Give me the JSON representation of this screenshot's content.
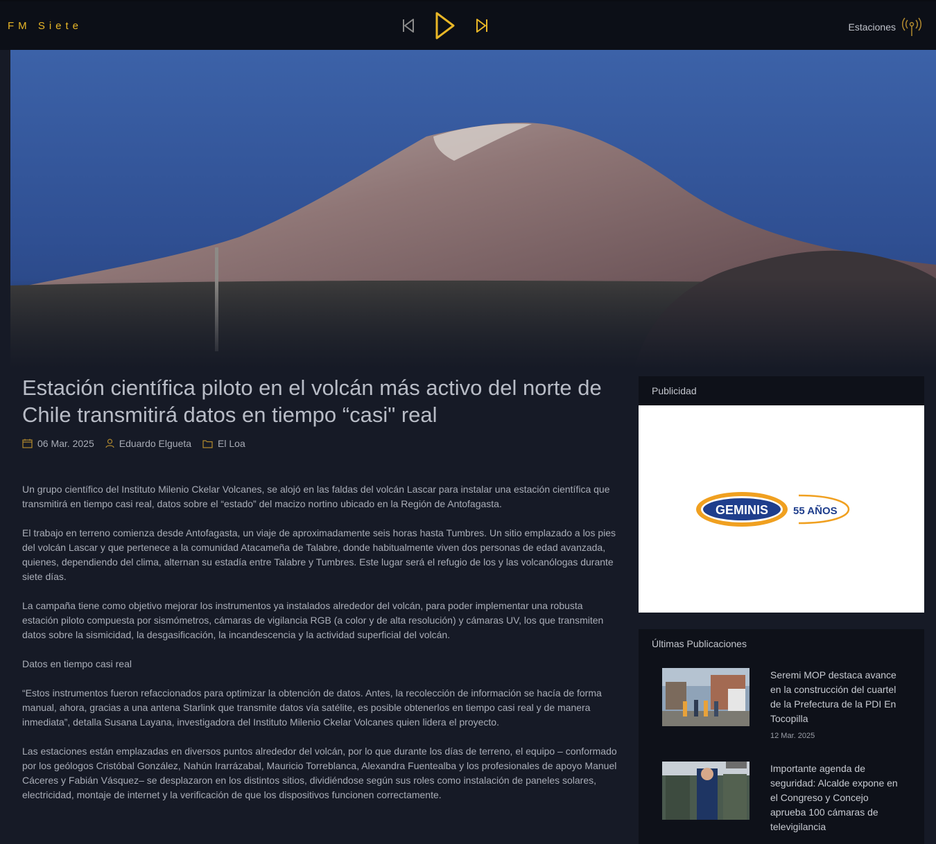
{
  "header": {
    "brand": "FM Siete",
    "stations_label": "Estaciones"
  },
  "article": {
    "title": "Estación científica piloto en el volcán más activo del norte de Chile transmitirá datos en tiempo “casi\" real",
    "date": "06 Mar. 2025",
    "author": "Eduardo Elgueta",
    "category": "El Loa",
    "paragraphs": [
      "Un grupo científico del Instituto Milenio Ckelar Volcanes, se alojó en las faldas del volcán Lascar para instalar una estación científica que transmitirá en tiempo casi real, datos sobre el “estado” del macizo nortino ubicado en la Región de Antofagasta.",
      "El trabajo en terreno comienza desde Antofagasta, un viaje de aproximadamente seis horas hasta Tumbres. Un sitio emplazado a los pies del volcán Lascar y que pertenece a la comunidad Atacameña de Talabre, donde habitualmente viven dos personas de edad avanzada, quienes, dependiendo del clima, alternan su estadía entre Talabre y Tumbres. Este lugar será el refugio de los y las volcanólogas durante siete días.",
      "La campaña tiene como objetivo mejorar los instrumentos ya instalados alrededor del volcán, para poder implementar una robusta estación piloto compuesta por sismómetros, cámaras de vigilancia RGB (a color y de alta resolución) y cámaras UV, los que transmiten datos sobre la sismicidad, la desgasificación, la incandescencia y la actividad superficial del volcán.",
      "Datos en tiempo casi real",
      "“Estos instrumentos fueron refaccionados para optimizar la obtención de datos. Antes, la recolección de información se hacía de forma manual, ahora, gracias a una antena Starlink que transmite datos vía satélite, es posible obtenerlos en tiempo casi real y de manera inmediata”, detalla Susana Layana, investigadora del Instituto Milenio Ckelar Volcanes quien lidera el proyecto.",
      "Las estaciones están emplazadas en diversos puntos alrededor del volcán, por lo que durante los días de terreno, el equipo – conformado por los geólogos Cristóbal González, Nahún Irarrázabal, Mauricio Torreblanca, Alexandra Fuentealba y los profesionales de apoyo Manuel Cáceres y Fabián Vásquez– se desplazaron en los distintos sitios, dividiéndose según sus roles como instalación de paneles solares, electricidad, montaje de internet y la verificación de que los dispositivos funcionen correctamente."
    ]
  },
  "sidebar": {
    "ad_title": "Publicidad",
    "ad_brand": "GEMINIS",
    "ad_years": "55 AÑOS",
    "latest_title": "Últimas Publicaciones",
    "posts": [
      {
        "title": "Seremi MOP destaca avance en la construcción del cuartel de la Prefectura de la PDI En Tocopilla",
        "date": "12 Mar. 2025"
      },
      {
        "title": "Importante agenda de seguridad: Alcalde expone en el Congreso y Concejo aprueba 100 cámaras de televigilancia",
        "date": ""
      }
    ]
  },
  "colors": {
    "accent": "#e9b727",
    "background": "#161a26",
    "topbar": "#0c0f17"
  }
}
